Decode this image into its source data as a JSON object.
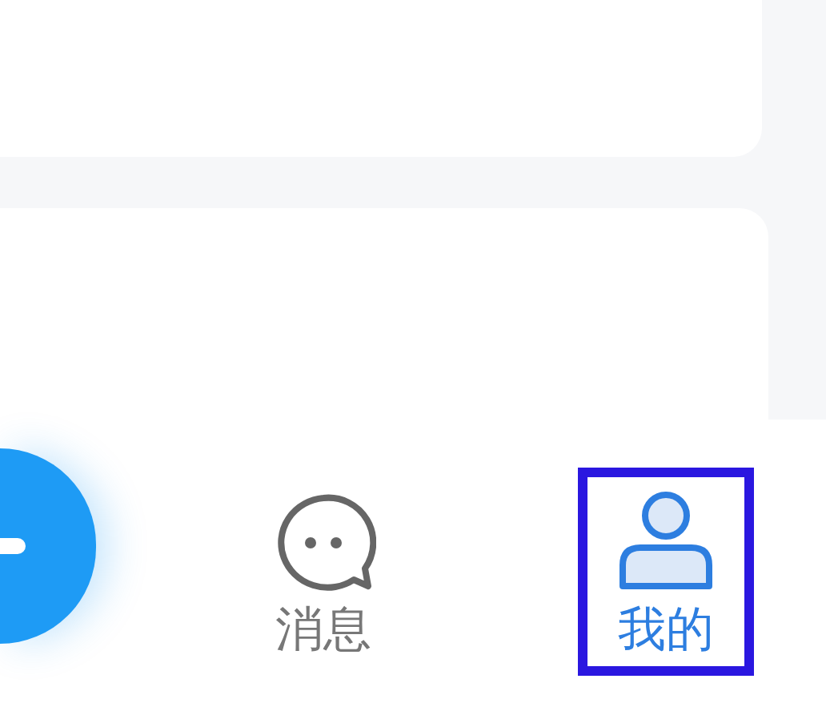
{
  "tabs": [
    {
      "label": "消息",
      "kind": "chat",
      "selected": false,
      "highlighted": false
    },
    {
      "label": "我的",
      "kind": "person",
      "selected": true,
      "highlighted": true
    }
  ]
}
